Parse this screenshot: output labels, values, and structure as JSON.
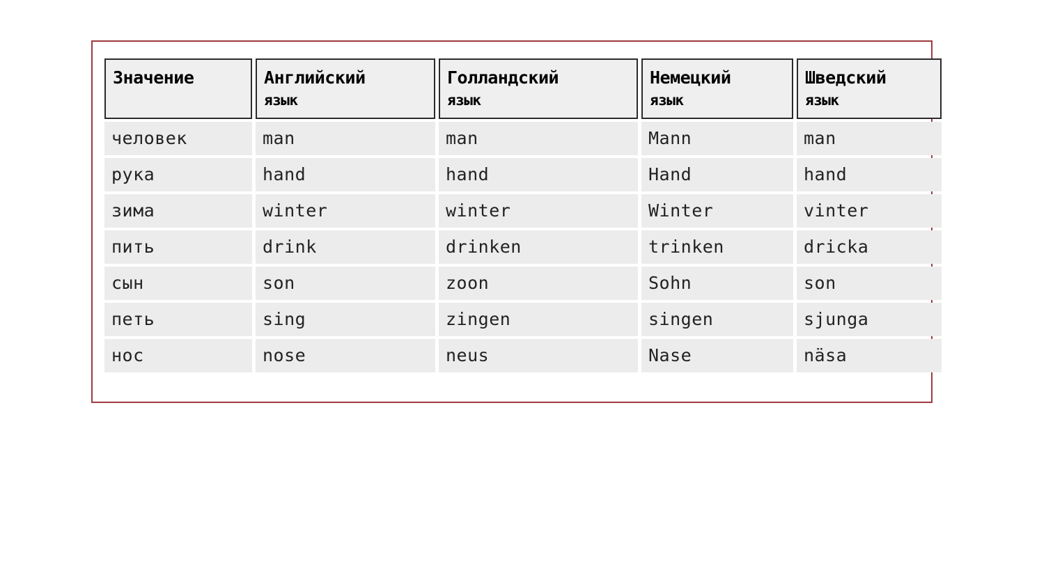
{
  "figure": {
    "kind": "comparison-table",
    "frame_color": "#9d3b3f",
    "header_bg": "#efefef",
    "header_border_color": "#2b2b2b",
    "row_bg": "#ececec",
    "page_bg": "#ffffff",
    "text_color": "#222222"
  },
  "table": {
    "columns": [
      {
        "title": "Значение",
        "subtitle": ""
      },
      {
        "title": "Английский",
        "subtitle": "язык"
      },
      {
        "title": "Голландский",
        "subtitle": "язык"
      },
      {
        "title": "Немецкий",
        "subtitle": "язык"
      },
      {
        "title": "Шведский",
        "subtitle": "язык"
      }
    ],
    "rows": [
      {
        "meaning": "человек",
        "english": "man",
        "dutch": "man",
        "german": "Mann",
        "swedish": "man"
      },
      {
        "meaning": "рука",
        "english": "hand",
        "dutch": "hand",
        "german": "Hand",
        "swedish": "hand"
      },
      {
        "meaning": "зима",
        "english": "winter",
        "dutch": "winter",
        "german": "Winter",
        "swedish": "vinter"
      },
      {
        "meaning": "пить",
        "english": "drink",
        "dutch": "drinken",
        "german": "trinken",
        "swedish": "dricka"
      },
      {
        "meaning": "сын",
        "english": "son",
        "dutch": "zoon",
        "german": "Sohn",
        "swedish": "son"
      },
      {
        "meaning": "петь",
        "english": "sing",
        "dutch": "zingen",
        "german": "singen",
        "swedish": "sjunga"
      },
      {
        "meaning": "нос",
        "english": "nose",
        "dutch": "neus",
        "german": "Nase",
        "swedish": "näsa"
      }
    ]
  }
}
